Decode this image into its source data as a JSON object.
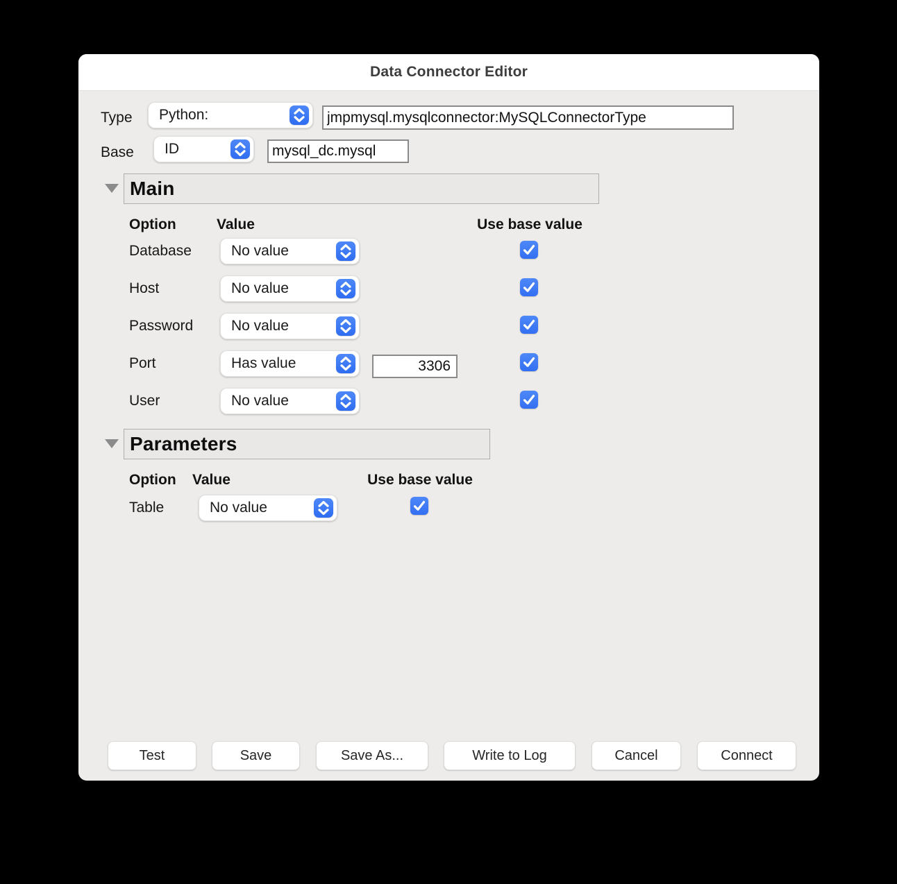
{
  "window": {
    "title": "Data Connector Editor"
  },
  "colors": {
    "accent_blue": "#3D7CF6",
    "body_background": "#EDECEA",
    "titlebar_background": "#FFFFFF",
    "section_header_background": "#E9E8E6"
  },
  "icons": {
    "stepper": "up-down-chevrons",
    "checkbox_check": "checkmark",
    "disclosure": "triangle-down"
  },
  "type_row": {
    "label": "Type",
    "selected": "Python:",
    "class_path": "jmpmysql.mysqlconnector:MySQLConnectorType"
  },
  "base_row": {
    "label": "Base",
    "selected": "ID",
    "value": "mysql_dc.mysql"
  },
  "main_section": {
    "title": "Main",
    "columns": {
      "option": "Option",
      "value": "Value",
      "use_base": "Use base value"
    },
    "rows": [
      {
        "option": "Database",
        "value": "No value",
        "use_base_checked": true
      },
      {
        "option": "Host",
        "value": "No value",
        "use_base_checked": true
      },
      {
        "option": "Password",
        "value": "No value",
        "use_base_checked": true
      },
      {
        "option": "Port",
        "value": "Has value",
        "port_value": "3306",
        "use_base_checked": true
      },
      {
        "option": "User",
        "value": "No value",
        "use_base_checked": true
      }
    ]
  },
  "parameters_section": {
    "title": "Parameters",
    "columns": {
      "option": "Option",
      "value": "Value",
      "use_base": "Use base value"
    },
    "rows": [
      {
        "option": "Table",
        "value": "No value",
        "use_base_checked": true
      }
    ]
  },
  "footer": {
    "buttons": [
      {
        "label": "Test"
      },
      {
        "label": "Save"
      },
      {
        "label": "Save As..."
      },
      {
        "label": "Write to Log"
      },
      {
        "label": "Cancel"
      },
      {
        "label": "Connect"
      }
    ]
  }
}
